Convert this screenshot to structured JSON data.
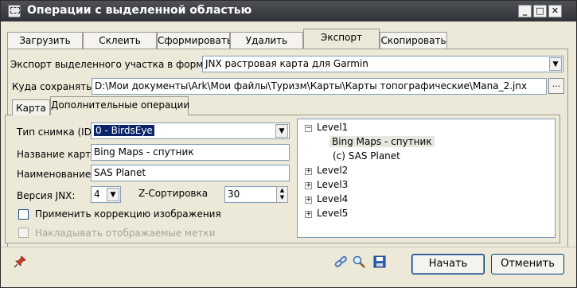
{
  "window": {
    "title": "Операции с выделенной областью"
  },
  "caption_buttons": {
    "minimize": "_",
    "maximize": "□",
    "close": "✕"
  },
  "main_tabs": [
    {
      "label": "Загрузить"
    },
    {
      "label": "Склеить"
    },
    {
      "label": "Сформировать"
    },
    {
      "label": "Удалить"
    },
    {
      "label": "Экспорт"
    },
    {
      "label": "Скопировать"
    }
  ],
  "export": {
    "format_label": "Экспорт выделенного участка в формат",
    "format_value": "JNX растровая карта для Garmin",
    "save_label": "Куда сохранять:",
    "save_path": "D:\\Мои документы\\Ark\\Мои файлы\\Туризм\\Карты\\Карты топографические\\Mana_2.jnx",
    "browse_label": "..."
  },
  "sub_tabs": [
    {
      "label": "Карта"
    },
    {
      "label": "Дополнительные операции"
    }
  ],
  "form": {
    "image_type_label": "Тип снимка (ID)",
    "image_type_value": "0 - BirdsEye",
    "map_name_label": "Название карты",
    "map_name_value": "Bing Maps - спутник",
    "naming_label": "Наименование:",
    "naming_value": "SAS Planet",
    "jnx_version_label": "Версия JNX:",
    "jnx_version_value": "4",
    "z_sort_label": "Z-Сортировка",
    "z_sort_value": "30",
    "apply_correction_label": "Применить коррекцию изображения",
    "overlay_marks_label": "Накладывать отображаемые метки"
  },
  "tree": {
    "level1": "Level1",
    "child1": "Bing Maps - спутник",
    "child2": "(c) SAS Planet",
    "level2": "Level2",
    "level3": "Level3",
    "level4": "Level4",
    "level5": "Level5"
  },
  "footer": {
    "start_label": "Начать",
    "cancel_label": "Отменить"
  },
  "icons": [
    "pin-icon",
    "link-icon",
    "zoom-icon",
    "save-icon",
    "chevron-down-icon",
    "spin-up-icon",
    "spin-down-icon"
  ],
  "colors": {
    "titlebar": "#3a3d42",
    "selection": "#0a246a",
    "window_bg": "#ece9d8"
  }
}
